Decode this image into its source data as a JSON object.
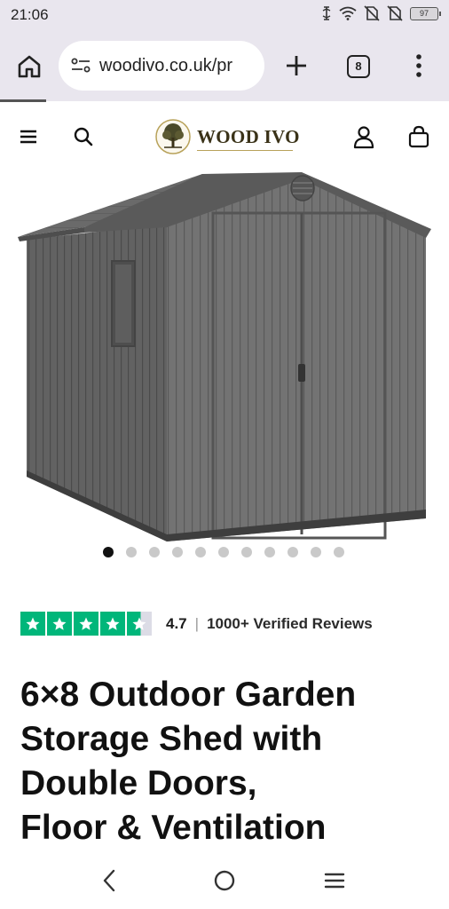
{
  "status_bar": {
    "time": "21:06",
    "battery": "97",
    "icons": [
      "vibrate-icon",
      "wifi-icon",
      "no-sim-icon",
      "no-sim-icon",
      "battery-icon"
    ]
  },
  "browser": {
    "url": "woodivo.co.uk/pr",
    "tab_count": "8",
    "icons": [
      "home-icon",
      "site-settings-icon",
      "new-tab-icon",
      "tab-switcher-icon",
      "more-options-icon"
    ]
  },
  "site_header": {
    "logo_text": "WOOD IVO",
    "icons": [
      "menu-icon",
      "search-icon",
      "tree-logo-icon",
      "account-icon",
      "cart-icon"
    ]
  },
  "carousel": {
    "slide_count": 11,
    "active_index": 0
  },
  "rating": {
    "stars": 4.7,
    "score": "4.7",
    "separator": "|",
    "reviews_label": "1000+ Verified Reviews",
    "star_color": "#00b67a"
  },
  "product": {
    "title_lines": [
      "6×8 Outdoor Garden",
      "Storage Shed with",
      "Double Doors,",
      "Floor & Ventilation"
    ]
  },
  "nav_bar": {
    "icons": [
      "back-icon",
      "home-circle-icon",
      "recents-menu-icon"
    ]
  },
  "colors": {
    "chrome_bg": "#e9e6ee",
    "shed_gray": "#6d6d6d",
    "trustpilot_green": "#00b67a",
    "logo_gold": "#b8a25a"
  }
}
